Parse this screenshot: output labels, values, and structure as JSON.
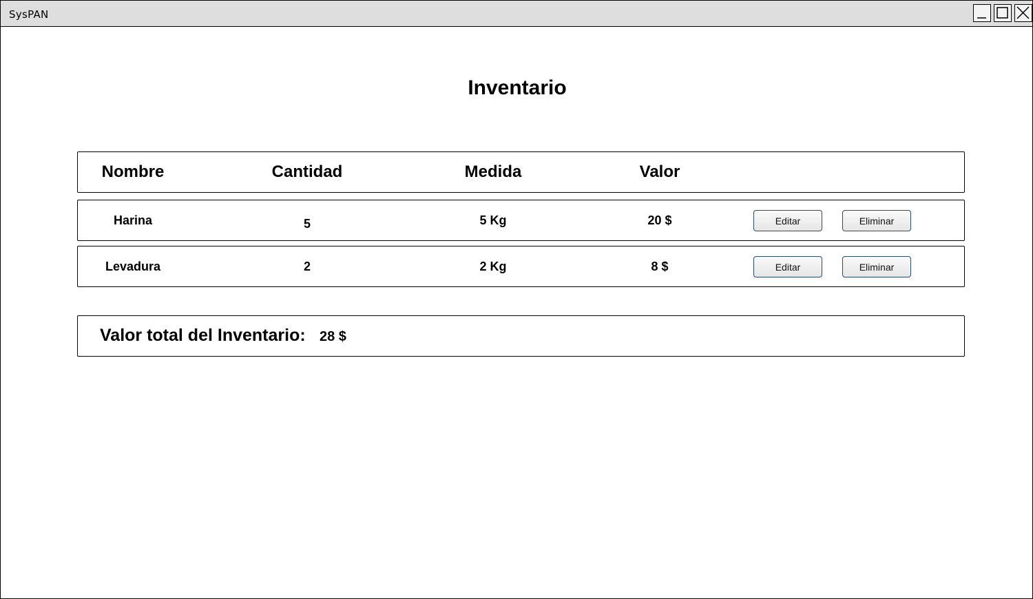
{
  "window": {
    "title": "SysPAN",
    "controls": [
      "minimize-icon",
      "maximize-icon",
      "close-icon"
    ]
  },
  "page": {
    "title": "Inventario"
  },
  "table": {
    "headers": [
      "Nombre",
      "Cantidad",
      "Medida",
      "Valor"
    ],
    "rows": [
      {
        "nombre": "Harina",
        "cantidad": "5",
        "medida": "5 Kg",
        "valor": "20 $"
      },
      {
        "nombre": "Levadura",
        "cantidad": "2",
        "medida": "2 Kg",
        "valor": "8 $"
      }
    ],
    "actions": {
      "edit_label": "Editar",
      "delete_label": "Eliminar"
    }
  },
  "summary": {
    "total_label": "Valor total del Inventario:",
    "total_value": "28 $"
  }
}
